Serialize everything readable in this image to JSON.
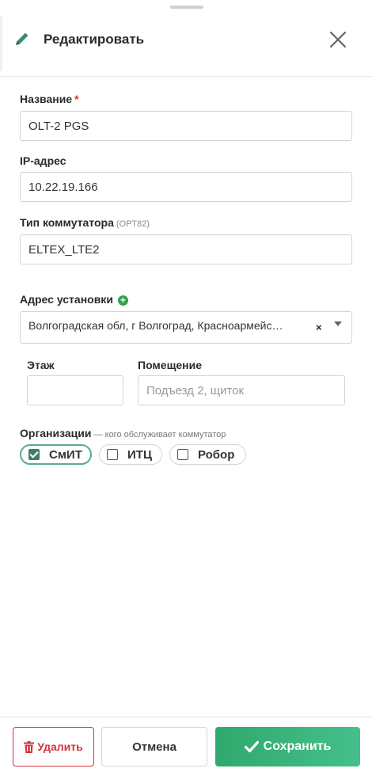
{
  "header": {
    "title": "Редактировать"
  },
  "form": {
    "name": {
      "label": "Название",
      "required_mark": "*",
      "value": "OLT-2 PGS"
    },
    "ip": {
      "label": "IP-адрес",
      "value": "10.22.19.166"
    },
    "switch_type": {
      "label": "Тип коммутатора",
      "hint": "(OPT82)",
      "value": "ELTEX_LTE2"
    },
    "address": {
      "label": "Адрес установки",
      "value": "Волгоградская обл, г Волгоград, Красноармейс…",
      "clear_label": "×"
    },
    "floor": {
      "label": "Этаж",
      "value": ""
    },
    "room": {
      "label": "Помещение",
      "placeholder": "Подъезд 2, щиток"
    },
    "organizations": {
      "label": "Организации",
      "hint": " — кого обслуживает коммутатор",
      "items": [
        {
          "label": "СмИТ",
          "checked": true
        },
        {
          "label": "ИТЦ",
          "checked": false
        },
        {
          "label": "Робор",
          "checked": false
        }
      ]
    }
  },
  "footer": {
    "delete_label": "Удалить",
    "cancel_label": "Отмена",
    "save_label": "Сохранить"
  },
  "colors": {
    "danger": "#d3353a",
    "success": "#2fa96c",
    "accent_check": "#3f7f69",
    "add_icon": "#2fa34d"
  }
}
